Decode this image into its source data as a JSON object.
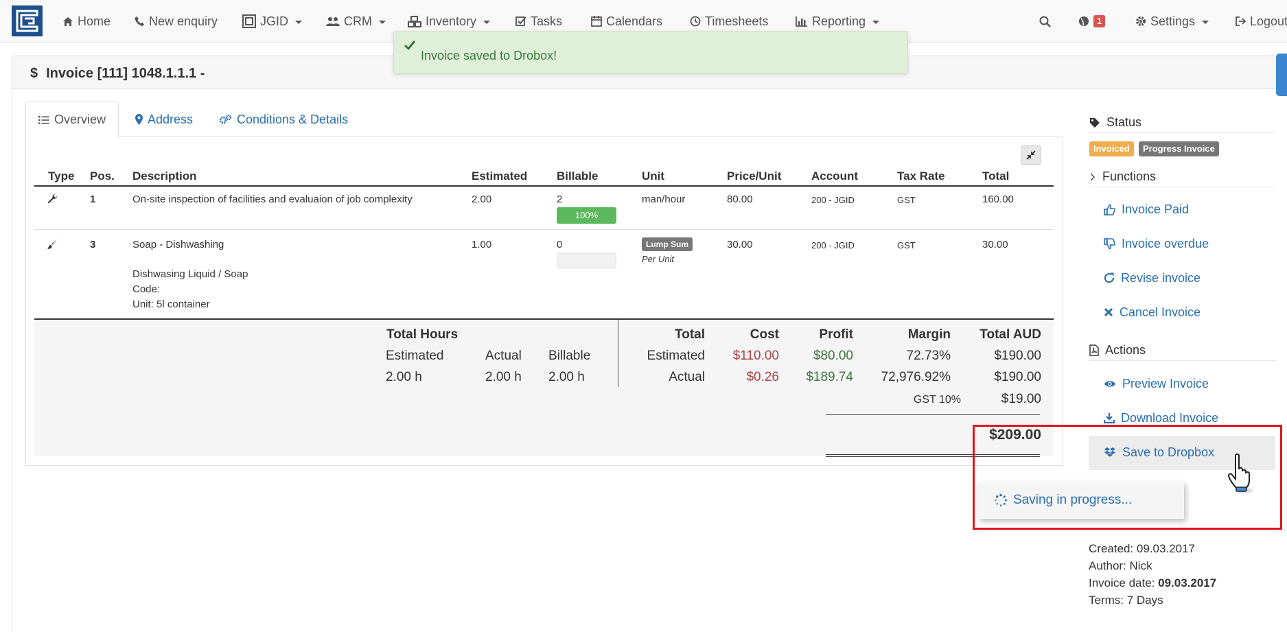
{
  "nav": {
    "items": [
      {
        "label": "Home",
        "icon": "home-icon"
      },
      {
        "label": "New enquiry",
        "icon": "phone-icon"
      },
      {
        "label": "JGID",
        "icon": "logo-square-icon"
      },
      {
        "label": "CRM",
        "icon": "users-icon"
      },
      {
        "label": "Inventory",
        "icon": "cubes-icon"
      },
      {
        "label": "Tasks",
        "icon": "check-square-icon"
      },
      {
        "label": "Calendars",
        "icon": "calendar-icon"
      },
      {
        "label": "Timesheets",
        "icon": "clock-icon"
      },
      {
        "label": "Reporting",
        "icon": "bar-chart-icon"
      }
    ],
    "notification_count": "1",
    "settings_label": "Settings",
    "logout_label": "Logout"
  },
  "toast": {
    "message": "Invoice saved to Drobox!"
  },
  "panel": {
    "title": "Invoice [111] 1048.1.1.1 -"
  },
  "tabs": [
    {
      "label": "Overview"
    },
    {
      "label": "Address"
    },
    {
      "label": "Conditions & Details"
    }
  ],
  "table": {
    "headers": [
      "Type",
      "Pos.",
      "Description",
      "Estimated",
      "Billable",
      "Unit",
      "Price/Unit",
      "Account",
      "Tax Rate",
      "Total"
    ],
    "rows": [
      {
        "type_icon": "wrench-icon",
        "pos": "1",
        "description": "On-site inspection of facilities and evaluaion of job complexity",
        "estimated": "2.00",
        "billable": "2",
        "billable_progress": 1.0,
        "billable_progress_label": "100%",
        "unit": "man/hour",
        "price": "80.00",
        "account": "200 - JGID",
        "tax": "GST",
        "total": "160.00"
      },
      {
        "type_icon": "paintbrush-icon",
        "pos": "3",
        "description": "Soap - Dishwashing",
        "description_lines": [
          "Dishwasing Liquid / Soap",
          "Code:",
          "Unit: 5l container"
        ],
        "estimated": "1.00",
        "billable": "0",
        "billable_progress": 0.0,
        "billable_progress_label": "0%",
        "unit_badge": "Lump Sum",
        "unit_sub": "Per Unit",
        "price": "30.00",
        "account": "200 - JGID",
        "tax": "GST",
        "total": "30.00"
      }
    ]
  },
  "summary": {
    "hours_title": "Total Hours",
    "hours_headers": [
      "Estimated",
      "Actual",
      "Billable"
    ],
    "hours_values": [
      "2.00 h",
      "2.00 h",
      "2.00 h"
    ],
    "money_headers": [
      "Total",
      "Cost",
      "Profit",
      "Margin",
      "Total AUD"
    ],
    "estimated_row": {
      "label": "Estimated",
      "cost": "$110.00",
      "profit": "$80.00",
      "margin": "72.73%",
      "total": "$190.00"
    },
    "actual_row": {
      "label": "Actual",
      "cost": "$0.26",
      "profit": "$189.74",
      "margin": "72,976.92%",
      "total": "$190.00"
    },
    "gst_label": "GST 10%",
    "gst_value": "$19.00",
    "grand_total": "$209.00"
  },
  "sidebar": {
    "status_title": "Status",
    "badges": [
      {
        "label": "Invoiced",
        "color": "#f0ad4e"
      },
      {
        "label": "Progress Invoice",
        "color": "#777777"
      }
    ],
    "functions_title": "Functions",
    "functions": [
      {
        "label": "Invoice Paid",
        "icon": "thumbs-up-icon"
      },
      {
        "label": "Invoice overdue",
        "icon": "thumbs-down-icon"
      },
      {
        "label": "Revise invoice",
        "icon": "refresh-icon"
      },
      {
        "label": "Cancel Invoice",
        "icon": "close-icon"
      }
    ],
    "actions_title": "Actions",
    "actions": [
      {
        "label": "Preview Invoice",
        "icon": "eye-icon"
      },
      {
        "label": "Download Invoice",
        "icon": "download-icon"
      },
      {
        "label": "Save to Dropbox",
        "icon": "dropbox-icon"
      }
    ],
    "saving_text": "Saving in progress...",
    "meta": {
      "created": "Created: 09.03.2017",
      "author": "Author: Nick",
      "invoice_date_label": "Invoice date: ",
      "invoice_date": "09.03.2017",
      "terms": "Terms: 7 Days"
    }
  }
}
